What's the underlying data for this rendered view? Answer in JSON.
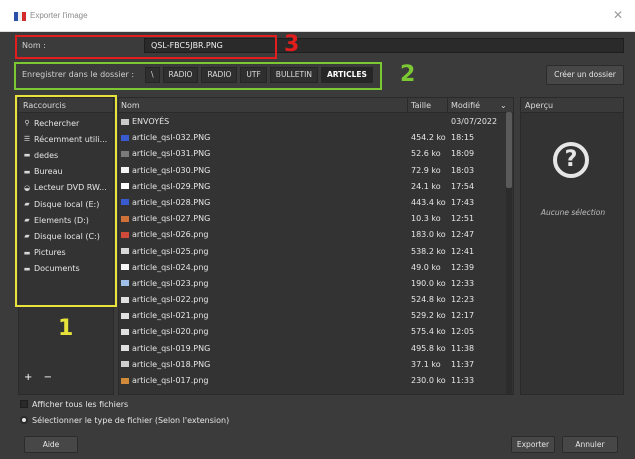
{
  "window": {
    "title": "Exporter l'image",
    "close_label": "✕"
  },
  "name": {
    "label": "Nom :",
    "value": "QSL-FBC5JBR.PNG"
  },
  "folder": {
    "label": "Enregistrer dans le dossier :",
    "crumbs": [
      "\\",
      "RADIO",
      "RADIO",
      "UTF",
      "BULLETIN",
      "ARTICLES"
    ],
    "create_label": "Créer un dossier"
  },
  "shortcuts": {
    "header": "Raccourcis",
    "items": [
      {
        "icon": "search-icon",
        "label": "Rechercher"
      },
      {
        "icon": "recent-icon",
        "label": "Récemment utili..."
      },
      {
        "icon": "folder-icon",
        "label": "dedes"
      },
      {
        "icon": "folder-icon",
        "label": "Bureau"
      },
      {
        "icon": "dvd-icon",
        "label": "Lecteur DVD RW..."
      },
      {
        "icon": "drive-icon",
        "label": "Disque local (E:)"
      },
      {
        "icon": "drive-icon",
        "label": "Elements (D:)"
      },
      {
        "icon": "drive-icon",
        "label": "Disque local (C:)"
      },
      {
        "icon": "folder-icon",
        "label": "Pictures"
      },
      {
        "icon": "folder-icon",
        "label": "Documents"
      }
    ],
    "add_label": "+",
    "remove_label": "−"
  },
  "files": {
    "headers": {
      "name": "Nom",
      "size": "Taille",
      "date": "Modifié"
    },
    "rows": [
      {
        "name": "ENVOYÉS",
        "size": "",
        "date": "03/07/2022",
        "thumb": "#c9c9c9"
      },
      {
        "name": "article_qsl-032.PNG",
        "size": "454.2 ko",
        "date": "18:15",
        "thumb": "#3a5bd0"
      },
      {
        "name": "article_qsl-031.PNG",
        "size": "52.6 ko",
        "date": "18:09",
        "thumb": "#7a7a7a"
      },
      {
        "name": "article_qsl-030.PNG",
        "size": "72.9 ko",
        "date": "18:03",
        "thumb": "#f2f2f2"
      },
      {
        "name": "article_qsl-029.PNG",
        "size": "24.1 ko",
        "date": "17:54",
        "thumb": "#ffffff"
      },
      {
        "name": "article_qsl-028.PNG",
        "size": "443.4 ko",
        "date": "17:43",
        "thumb": "#3a5bd0"
      },
      {
        "name": "article_qsl-027.PNG",
        "size": "10.3 ko",
        "date": "12:51",
        "thumb": "#d0713a"
      },
      {
        "name": "article_qsl-026.png",
        "size": "183.0 ko",
        "date": "12:47",
        "thumb": "#d04a3a"
      },
      {
        "name": "article_qsl-025.png",
        "size": "538.2 ko",
        "date": "12:41",
        "thumb": "#d8d8d8"
      },
      {
        "name": "article_qsl-024.png",
        "size": "49.0 ko",
        "date": "12:39",
        "thumb": "#f5f5f5"
      },
      {
        "name": "article_qsl-023.png",
        "size": "190.0 ko",
        "date": "12:33",
        "thumb": "#9ec0e8"
      },
      {
        "name": "article_qsl-022.png",
        "size": "524.8 ko",
        "date": "12:23",
        "thumb": "#e0e0e0"
      },
      {
        "name": "article_qsl-021.png",
        "size": "529.2 ko",
        "date": "12:17",
        "thumb": "#e0e0e0"
      },
      {
        "name": "article_qsl-020.png",
        "size": "575.4 ko",
        "date": "12:05",
        "thumb": "#e0e0e0"
      },
      {
        "name": "article_qsl-019.PNG",
        "size": "495.8 ko",
        "date": "11:38",
        "thumb": "#e0e0e0"
      },
      {
        "name": "article_qsl-018.PNG",
        "size": "37.1 ko",
        "date": "11:37",
        "thumb": "#cfcfcf"
      },
      {
        "name": "article_qsl-017.png",
        "size": "230.0 ko",
        "date": "11:33",
        "thumb": "#d08a3a"
      }
    ]
  },
  "preview": {
    "header": "Aperçu",
    "empty_text": "Aucune sélection",
    "icon_glyph": "?"
  },
  "options": {
    "show_all": "Afficher tous les fichiers",
    "file_type": "Sélectionner le type de fichier (Selon l'extension)"
  },
  "buttons": {
    "help": "Aide",
    "export": "Exporter",
    "cancel": "Annuler"
  },
  "annotations": {
    "one": "1",
    "two": "2",
    "three": "3"
  }
}
